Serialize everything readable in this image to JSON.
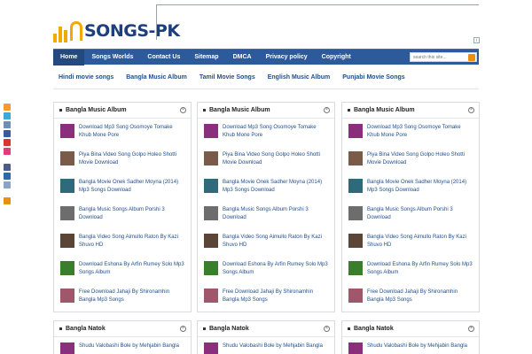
{
  "header": {
    "logo_text": "SONGS-PK",
    "adchoice_label": "i"
  },
  "colors": {
    "nav_bg": "#2d5a9a",
    "nav_active": "#23497f",
    "link": "#1f4e8c",
    "logo_accent": "#f2a900",
    "logo_text": "#1d3f7d"
  },
  "topnav": {
    "items": [
      "Home",
      "Songs Worlds",
      "Contact Us",
      "Sitemap",
      "DMCA",
      "Privacy policy",
      "Copyright"
    ],
    "active": "Home",
    "search_placeholder": "search this site..."
  },
  "subnav": {
    "items": [
      "Hindi movie songs",
      "Bangla Music Album",
      "Tamil Movie Songs",
      "English Music Album",
      "Punjabi Movie Songs"
    ]
  },
  "social_icons": [
    "rss-icon",
    "twitter-icon",
    "delicious-icon",
    "facebook-icon",
    "youtube-icon",
    "flickr-icon",
    "myspace-icon",
    "linkedin-icon",
    "email-icon",
    "feed-icon"
  ],
  "widgets": [
    {
      "title": "Bangla Music Album",
      "items": [
        "Download Mp3 Song Osomoye Tomake Khub Mone Pore",
        "Piya Bina Video Song Golpo Holeo Shotti Movie Download",
        "Bangla Movie Onek Sadher Moyna (2014) Mp3 Songs Download",
        "Bangla Music Songs Album Porshi 3 Download",
        "Bangla Video Song Aimullo Raton By Kazi Shuvo HD",
        "Download Eshona By Arfin Rumey Solo Mp3 Songs Album",
        "Free Download Jahaji By Shironamhin Bangla Mp3 Songs"
      ]
    },
    {
      "title": "Bangla Music Album",
      "items": [
        "Download Mp3 Song Osomoye Tomake Khub Mone Pore",
        "Piya Bina Video Song Golpo Holeo Shotti Movie Download",
        "Bangla Movie Onek Sadher Moyna (2014) Mp3 Songs Download",
        "Bangla Music Songs Album Porshi 3 Download",
        "Bangla Video Song Aimullo Raton By Kazi Shuvo HD",
        "Download Eshona By Arfin Rumey Solo Mp3 Songs Album",
        "Free Download Jahaji By Shironamhin Bangla Mp3 Songs"
      ]
    },
    {
      "title": "Bangla Music Album",
      "items": [
        "Download Mp3 Song Osomoye Tomake Khub Mone Pore",
        "Piya Bina Video Song Golpo Holeo Shotti Movie Download",
        "Bangla Movie Onek Sadher Moyna (2014) Mp3 Songs Download",
        "Bangla Music Songs Album Porshi 3 Download",
        "Bangla Video Song Aimullo Raton By Kazi Shuvo HD",
        "Download Eshona By Arfin Rumey Solo Mp3 Songs Album",
        "Free Download Jahaji By Shironamhin Bangla Mp3 Songs"
      ]
    },
    {
      "title": "Bangla Natok",
      "items": [
        "Shudu Valobashi Bole by Mehjabin Bangla"
      ]
    },
    {
      "title": "Bangla Natok",
      "items": [
        "Shudu Valobashi Bole by Mehjabin Bangla"
      ]
    },
    {
      "title": "Bangla Natok",
      "items": [
        "Shudu Valobashi Bole by Mehjabin Bangla"
      ]
    }
  ]
}
